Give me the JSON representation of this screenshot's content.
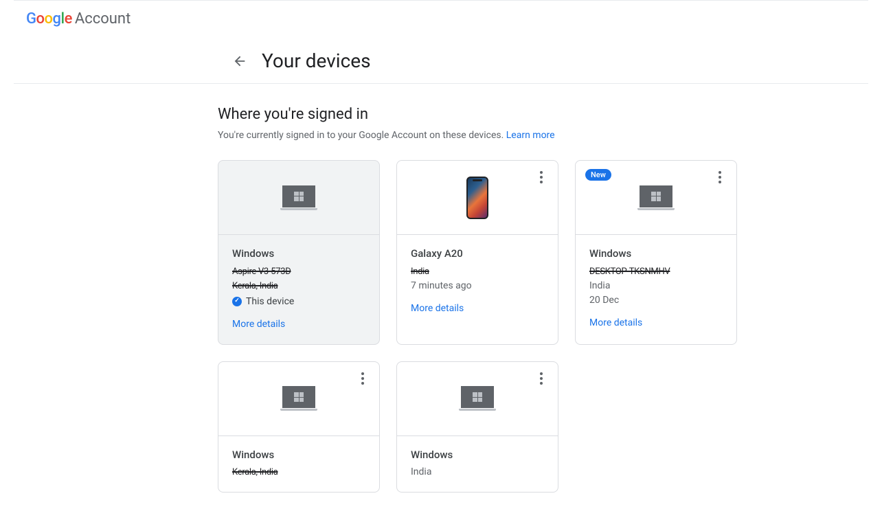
{
  "header": {
    "brand_g": "G",
    "brand_o1": "o",
    "brand_o2": "o",
    "brand_g2": "g",
    "brand_l": "l",
    "brand_e": "e",
    "account_word": "Account"
  },
  "page": {
    "title": "Your devices",
    "section_title": "Where you're signed in",
    "section_sub": "You're currently signed in to your Google Account on these devices. ",
    "learn_more": "Learn more"
  },
  "badges": {
    "new": "New",
    "this_device": "This device"
  },
  "devices": [
    {
      "name": "Windows",
      "line1_redacted": "Aspire V3-573D",
      "line2_redacted": "Kerala, India",
      "this_device": true,
      "more": "More details",
      "icon": "laptop",
      "current": true,
      "show_menu": false,
      "new": false
    },
    {
      "name": "Galaxy A20",
      "line1_redacted": "India",
      "line2": "7 minutes ago",
      "more": "More details",
      "icon": "phone",
      "current": false,
      "show_menu": true,
      "new": false
    },
    {
      "name": "Windows",
      "line1_redacted": "DESKTOP-TKSNMHV",
      "line2": "India",
      "line3": "20 Dec",
      "more": "More details",
      "icon": "laptop",
      "current": false,
      "show_menu": true,
      "new": true
    },
    {
      "name": "Windows",
      "line1_redacted": "Kerala, India",
      "icon": "laptop",
      "current": false,
      "show_menu": true,
      "new": false
    },
    {
      "name": "Windows",
      "line1": "India",
      "icon": "laptop",
      "current": false,
      "show_menu": true,
      "new": false
    }
  ]
}
